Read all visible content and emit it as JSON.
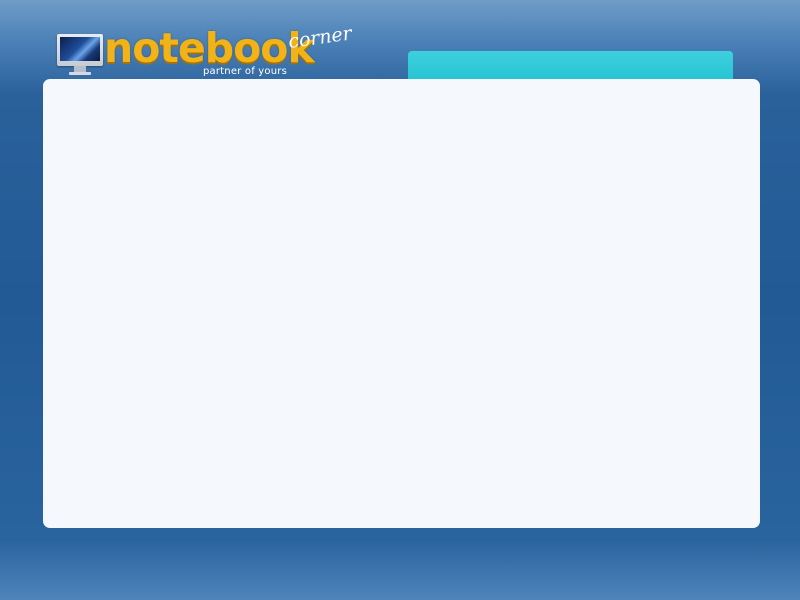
{
  "header": {
    "logo": {
      "brand_word": "notebook",
      "brand_suffix": "corner",
      "tagline": "partner of yours",
      "icon": "imac-monitor-icon"
    },
    "tab_strip": {
      "label": ""
    }
  },
  "main": {
    "content": ""
  },
  "colors": {
    "background": "#215a95",
    "brand_gold": "#f2b318",
    "tab_cyan": "#22c2d2",
    "panel": "#f5f9fe"
  }
}
